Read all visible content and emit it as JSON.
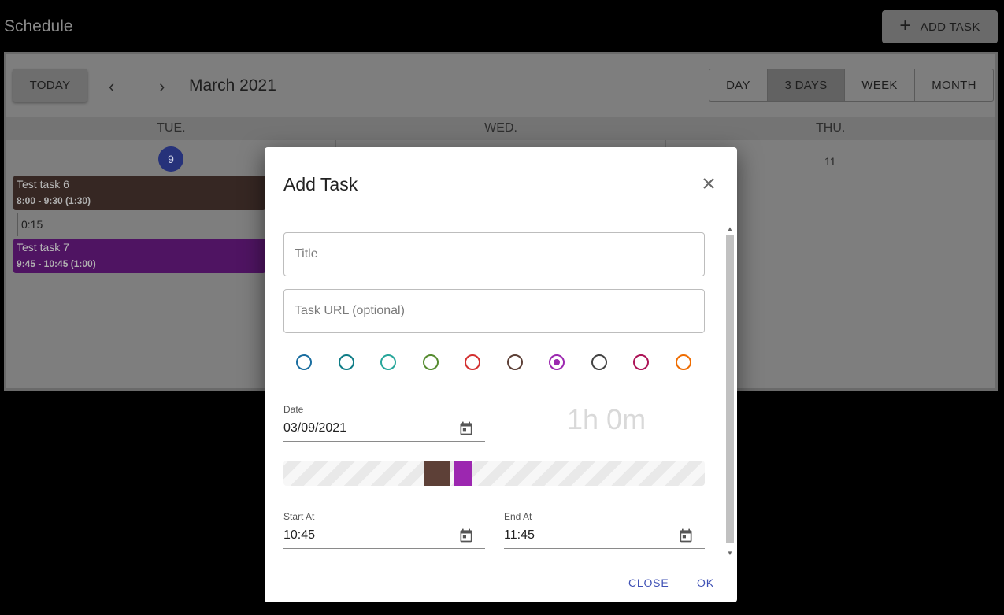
{
  "app": {
    "title": "Schedule",
    "add_task_label": "ADD TASK"
  },
  "toolbar": {
    "today_label": "TODAY",
    "month_label": "March 2021",
    "views": [
      "DAY",
      "3 DAYS",
      "WEEK",
      "MONTH"
    ],
    "active_view": "3 DAYS"
  },
  "days": [
    {
      "name": "TUE.",
      "number": "9"
    },
    {
      "name": "WED.",
      "number": ""
    },
    {
      "name": "THU.",
      "number": "11"
    }
  ],
  "events": [
    {
      "title": "Test task 6",
      "time": "8:00 - 9:30 (1:30)",
      "color": "#362723"
    },
    {
      "title": "Test task 7",
      "time": "9:45 - 10:45 (1:00)",
      "color": "#4f1462"
    }
  ],
  "gap_label": "0:15",
  "dialog": {
    "title": "Add Task",
    "title_placeholder": "Title",
    "url_placeholder": "Task URL (optional)",
    "colors": [
      "#1a6ea0",
      "#0e7c86",
      "#26a69a",
      "#558b2f",
      "#d32f2f",
      "#5d4037",
      "#9c27b0",
      "#424242",
      "#ad1457",
      "#ef6c00"
    ],
    "selected_color_index": 6,
    "date_label": "Date",
    "date_value": "03/09/2021",
    "duration": "1h 0m",
    "start_label": "Start At",
    "start_value": "10:45",
    "end_label": "End At",
    "end_value": "11:45",
    "close_label": "CLOSE",
    "ok_label": "OK",
    "slot_colors": [
      "#5d4037",
      "#9c27b0"
    ]
  }
}
